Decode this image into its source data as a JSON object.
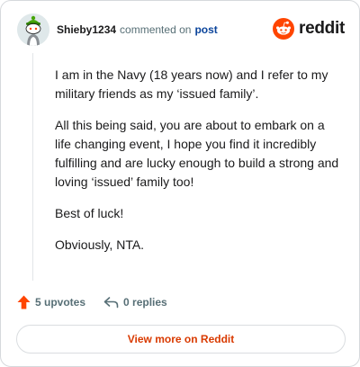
{
  "header": {
    "username": "Shieby1234",
    "action_text": "commented on",
    "target_link": "post"
  },
  "logo": {
    "text": "reddit",
    "icon": "reddit-snoo-icon",
    "brand_color": "#ff4500"
  },
  "comment": {
    "paragraphs": [
      "I am in the Navy (18 years now) and I refer to my military friends as my ‘issued family’.",
      "All this being said, you are about to embark on a life changing event, I hope you find it incredibly fulfilling and are lucky enough to build a strong and loving ‘issued’ family too!",
      "Best of luck!",
      "Obviously, NTA."
    ]
  },
  "actions": {
    "upvotes_label": "5 upvotes",
    "upvote_icon": "upvote-arrow-icon",
    "upvote_color": "#ff4500",
    "replies_label": "0 replies",
    "reply_icon": "reply-arrow-icon"
  },
  "footer": {
    "view_more_label": "View more on Reddit",
    "accent_color": "#d93a00"
  }
}
